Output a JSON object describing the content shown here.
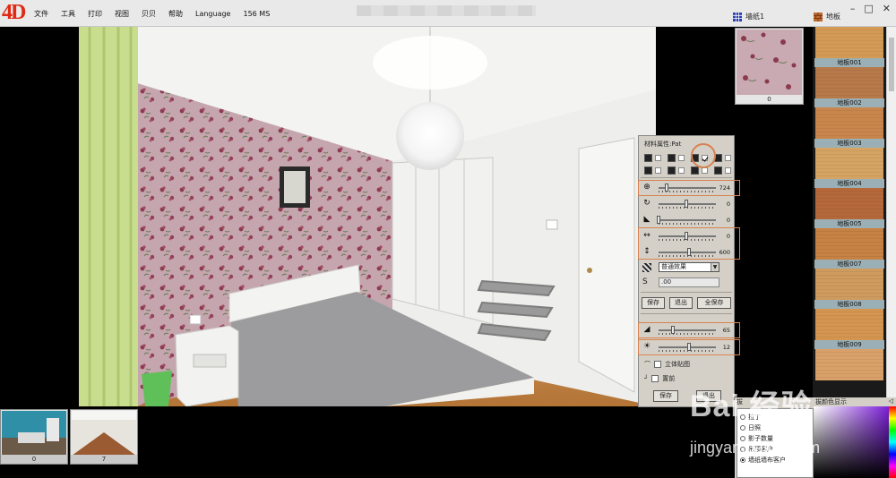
{
  "app": {
    "logo_text": "4D",
    "menu": [
      "文件",
      "工具",
      "打印",
      "视图",
      "贝贝",
      "帮助",
      "Language",
      "156 MS"
    ]
  },
  "categories": {
    "wallpaper": "墙纸1",
    "floor": "地板"
  },
  "wall_thumb": {
    "caption": "0",
    "colors": {
      "base": "#c9a9b2",
      "flower": "#8b3a4e",
      "leaf": "#6b7a5a"
    }
  },
  "floors": [
    {
      "label": "地板001",
      "color": "#d39a55"
    },
    {
      "label": "地板002",
      "color": "#b7794a"
    },
    {
      "label": "地板003",
      "color": "#c9864c"
    },
    {
      "label": "地板004",
      "color": "#d5a464"
    },
    {
      "label": "地板005",
      "color": "#b5683a"
    },
    {
      "label": "地板007",
      "color": "#c68143"
    },
    {
      "label": "地板008",
      "color": "#cf9b5e"
    },
    {
      "label": "地板009",
      "color": "#d49550"
    },
    {
      "label": "",
      "color": "#d9a06a"
    }
  ],
  "panel": {
    "title": "材料属性:Pat",
    "sliders": [
      {
        "icon": "zoom-icon",
        "glyph": "⊕",
        "value": "724",
        "pos": 0.15
      },
      {
        "icon": "rotate-icon",
        "glyph": "↻",
        "value": "0",
        "pos": 0.5
      },
      {
        "icon": "tilt-icon",
        "glyph": "◣",
        "value": "0",
        "pos": 0.0
      },
      {
        "icon": "horizontal-icon",
        "glyph": "↔",
        "value": "0",
        "pos": 0.5
      },
      {
        "icon": "vertical-icon",
        "glyph": "↕",
        "value": "600",
        "pos": 0.55
      }
    ],
    "effect": "普通效果",
    "number_field": ".00",
    "buttons": {
      "save": "保存",
      "exit": "退出",
      "save_all": "全保存"
    },
    "sliders2": [
      {
        "icon": "brightness-icon",
        "glyph": "◢",
        "value": "65",
        "pos": 0.25
      },
      {
        "icon": "sun-icon",
        "glyph": "☀",
        "value": "12",
        "pos": 0.55
      }
    ],
    "check_3d": "立体贴图",
    "check_front": "置前",
    "buttons2": {
      "save": "保存",
      "exit": "退出"
    }
  },
  "color_panel": {
    "label": "拔",
    "hint": "拔颜色显示",
    "corner": "◁",
    "options": [
      {
        "label": "拉丁",
        "selected": false
      },
      {
        "label": "日照",
        "selected": false
      },
      {
        "label": "影子数量",
        "selected": false
      },
      {
        "label": "吊顶客户",
        "selected": false
      },
      {
        "label": "墙纸墙布客户",
        "selected": true
      }
    ]
  },
  "bottom_thumbs": [
    {
      "caption": "0"
    },
    {
      "caption": "7"
    }
  ],
  "watermark": {
    "text": "Bai 经验",
    "url": "jingyan.baidu.com"
  }
}
